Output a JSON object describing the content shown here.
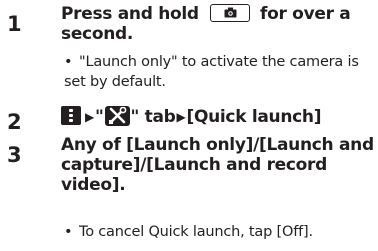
{
  "steps": [
    {
      "number": "1",
      "line1_before_icon": "Press and hold ",
      "line1_after_icon": " for over a",
      "line2": "second.",
      "note_line1": "\"Launch only\" to activate the camera is",
      "note_line2": "set by default."
    },
    {
      "number": "2",
      "quote_open": "\"",
      "quote_close": "\" tab",
      "quick_launch": "[Quick launch]"
    },
    {
      "number": "3",
      "line1": "Any of [Launch only]/[Launch and",
      "line2": "capture]/[Launch and record",
      "line3": "video].",
      "note": "To cancel Quick launch, tap [Off]."
    }
  ],
  "icons": {
    "camera_key": "camera-key-icon",
    "menu_key": "menu-key-icon",
    "arrow": "right-triangle-arrow-icon",
    "tools": "tools-tab-icon",
    "bullet": "•",
    "arrow_glyph": "▶"
  },
  "colors": {
    "text": "#231f20",
    "background": "#ffffff"
  }
}
